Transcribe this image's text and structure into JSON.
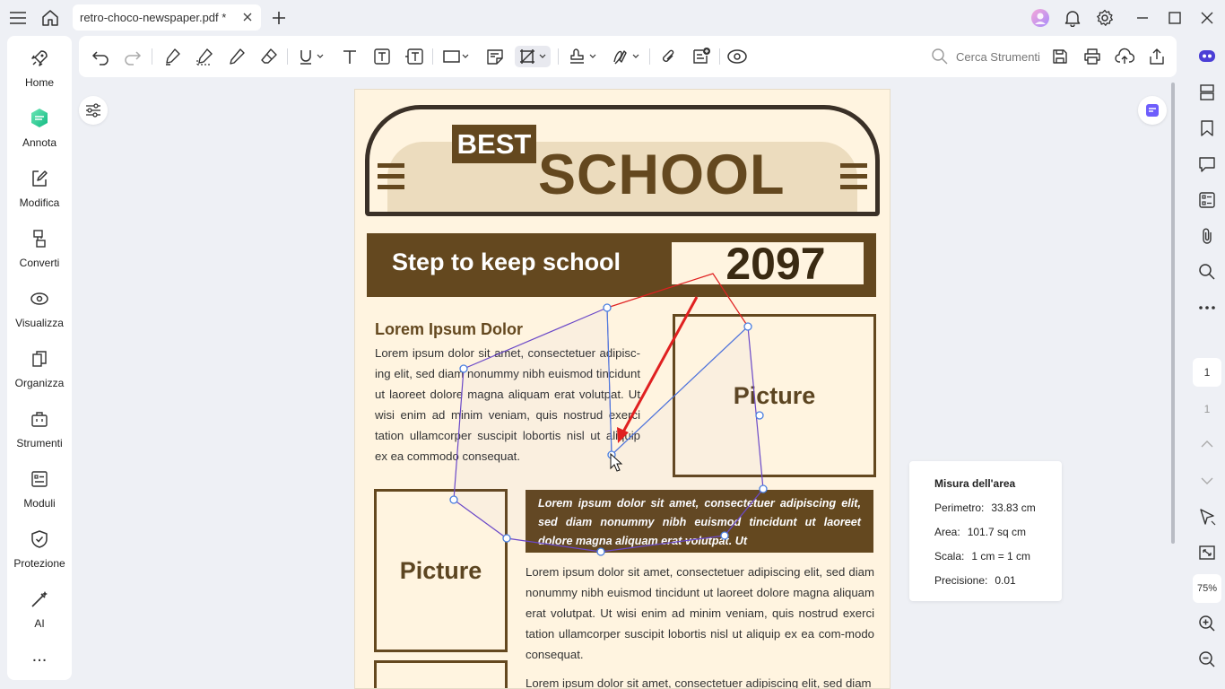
{
  "window": {
    "tab_title": "retro-choco-newspaper.pdf *",
    "icons": [
      "menu-icon",
      "home-icon",
      "close-icon",
      "plus-icon",
      "avatar",
      "bell-icon",
      "gear-icon",
      "minimize-icon",
      "maximize-icon",
      "close-window-icon"
    ]
  },
  "sidebar": {
    "items": [
      {
        "label": "Home",
        "icon": "rocket-icon"
      },
      {
        "label": "Annota",
        "icon": "annotate-icon"
      },
      {
        "label": "Modifica",
        "icon": "edit-icon"
      },
      {
        "label": "Converti",
        "icon": "convert-icon"
      },
      {
        "label": "Visualizza",
        "icon": "eye-icon"
      },
      {
        "label": "Organizza",
        "icon": "organize-icon"
      },
      {
        "label": "Strumenti",
        "icon": "toolbox-icon"
      },
      {
        "label": "Moduli",
        "icon": "form-icon"
      },
      {
        "label": "Protezione",
        "icon": "shield-icon"
      },
      {
        "label": "AI",
        "icon": "magic-wand-icon"
      }
    ],
    "more": "..."
  },
  "toolbar": {
    "search_placeholder": "Cerca Strumenti"
  },
  "document": {
    "best": "BEST",
    "school": "SCHOOL",
    "banner": "Step to keep school",
    "year": "2097",
    "article_title": "Lorem Ipsum Dolor",
    "article_body": "Lorem ipsum dolor sit amet, consectetuer adipisc-ing elit, sed diam nonummy nibh euismod tincidunt ut laoreet dolore magna aliquam erat volutpat. Ut wisi enim ad minim veniam, quis nostrud exerci tation ullamcorper suscipit lobortis nisl ut aliquip ex ea commodo consequat.",
    "picture_label": "Picture",
    "quote": "Lorem ipsum dolor sit amet, consectetuer adipiscing elit, sed diam nonummy nibh euismod tincidunt ut laoreet dolore magna aliquam erat volutpat. Ut",
    "body2": "Lorem ipsum dolor sit amet, consectetuer adipiscing elit, sed diam nonummy nibh euismod tincidunt ut laoreet dolore magna aliquam erat volutpat. Ut wisi enim ad minim veniam, quis nostrud exerci tation ullamcorper suscipit lobortis nisl ut aliquip ex ea com-modo consequat.",
    "body3": "Lorem ipsum dolor sit amet, consectetuer adipiscing elit, sed diam"
  },
  "measure": {
    "title": "Misura dell'area",
    "perimeter_label": "Perimetro:",
    "perimeter": "33.83 cm",
    "area_label": "Area:",
    "area": "101.7 sq cm",
    "scale_label": "Scala:",
    "scale": "1 cm = 1 cm",
    "precision_label": "Precisione:",
    "precision": "0.01"
  },
  "right_panel": {
    "current_page": "1",
    "total_pages": "1",
    "zoom": "75%"
  },
  "colors": {
    "accent_brown": "#64481f",
    "paper": "#fff4e0",
    "measure_line": "#4a7fe0",
    "arrow_red": "#e02020"
  }
}
